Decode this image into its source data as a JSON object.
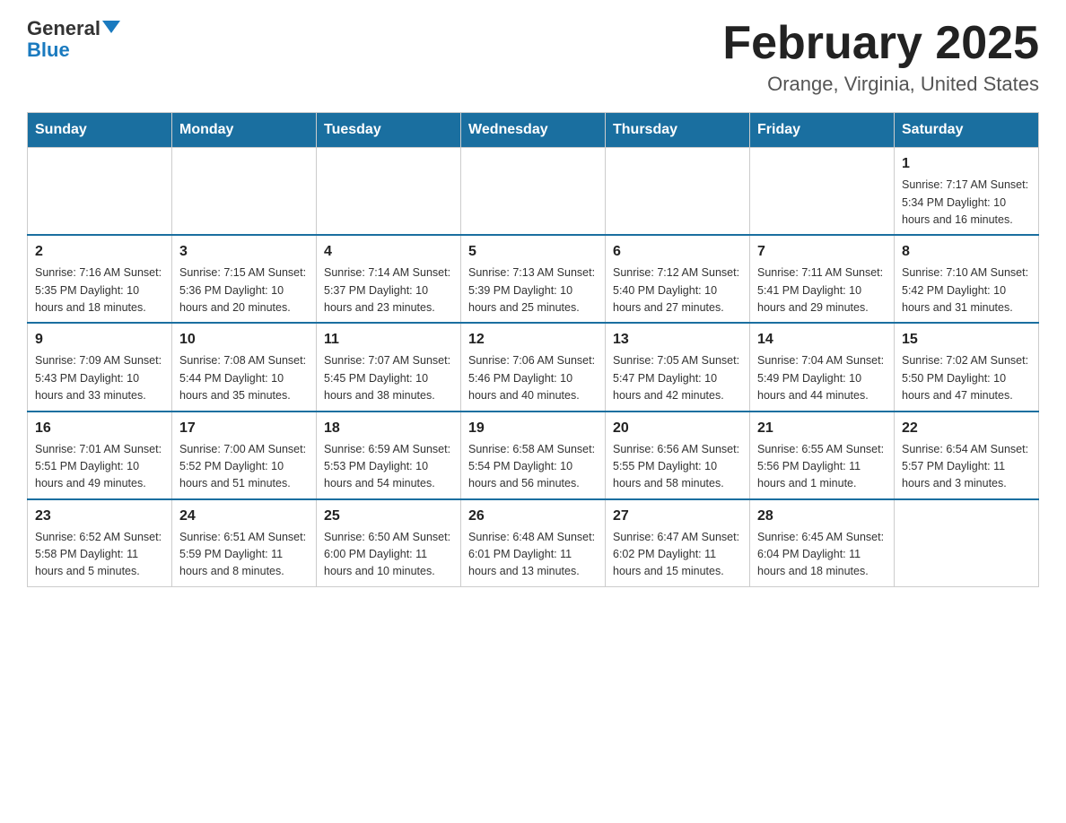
{
  "header": {
    "logo_general": "General",
    "logo_blue": "Blue",
    "month_title": "February 2025",
    "location": "Orange, Virginia, United States"
  },
  "weekdays": [
    "Sunday",
    "Monday",
    "Tuesday",
    "Wednesday",
    "Thursday",
    "Friday",
    "Saturday"
  ],
  "weeks": [
    [
      {
        "day": "",
        "info": ""
      },
      {
        "day": "",
        "info": ""
      },
      {
        "day": "",
        "info": ""
      },
      {
        "day": "",
        "info": ""
      },
      {
        "day": "",
        "info": ""
      },
      {
        "day": "",
        "info": ""
      },
      {
        "day": "1",
        "info": "Sunrise: 7:17 AM\nSunset: 5:34 PM\nDaylight: 10 hours\nand 16 minutes."
      }
    ],
    [
      {
        "day": "2",
        "info": "Sunrise: 7:16 AM\nSunset: 5:35 PM\nDaylight: 10 hours\nand 18 minutes."
      },
      {
        "day": "3",
        "info": "Sunrise: 7:15 AM\nSunset: 5:36 PM\nDaylight: 10 hours\nand 20 minutes."
      },
      {
        "day": "4",
        "info": "Sunrise: 7:14 AM\nSunset: 5:37 PM\nDaylight: 10 hours\nand 23 minutes."
      },
      {
        "day": "5",
        "info": "Sunrise: 7:13 AM\nSunset: 5:39 PM\nDaylight: 10 hours\nand 25 minutes."
      },
      {
        "day": "6",
        "info": "Sunrise: 7:12 AM\nSunset: 5:40 PM\nDaylight: 10 hours\nand 27 minutes."
      },
      {
        "day": "7",
        "info": "Sunrise: 7:11 AM\nSunset: 5:41 PM\nDaylight: 10 hours\nand 29 minutes."
      },
      {
        "day": "8",
        "info": "Sunrise: 7:10 AM\nSunset: 5:42 PM\nDaylight: 10 hours\nand 31 minutes."
      }
    ],
    [
      {
        "day": "9",
        "info": "Sunrise: 7:09 AM\nSunset: 5:43 PM\nDaylight: 10 hours\nand 33 minutes."
      },
      {
        "day": "10",
        "info": "Sunrise: 7:08 AM\nSunset: 5:44 PM\nDaylight: 10 hours\nand 35 minutes."
      },
      {
        "day": "11",
        "info": "Sunrise: 7:07 AM\nSunset: 5:45 PM\nDaylight: 10 hours\nand 38 minutes."
      },
      {
        "day": "12",
        "info": "Sunrise: 7:06 AM\nSunset: 5:46 PM\nDaylight: 10 hours\nand 40 minutes."
      },
      {
        "day": "13",
        "info": "Sunrise: 7:05 AM\nSunset: 5:47 PM\nDaylight: 10 hours\nand 42 minutes."
      },
      {
        "day": "14",
        "info": "Sunrise: 7:04 AM\nSunset: 5:49 PM\nDaylight: 10 hours\nand 44 minutes."
      },
      {
        "day": "15",
        "info": "Sunrise: 7:02 AM\nSunset: 5:50 PM\nDaylight: 10 hours\nand 47 minutes."
      }
    ],
    [
      {
        "day": "16",
        "info": "Sunrise: 7:01 AM\nSunset: 5:51 PM\nDaylight: 10 hours\nand 49 minutes."
      },
      {
        "day": "17",
        "info": "Sunrise: 7:00 AM\nSunset: 5:52 PM\nDaylight: 10 hours\nand 51 minutes."
      },
      {
        "day": "18",
        "info": "Sunrise: 6:59 AM\nSunset: 5:53 PM\nDaylight: 10 hours\nand 54 minutes."
      },
      {
        "day": "19",
        "info": "Sunrise: 6:58 AM\nSunset: 5:54 PM\nDaylight: 10 hours\nand 56 minutes."
      },
      {
        "day": "20",
        "info": "Sunrise: 6:56 AM\nSunset: 5:55 PM\nDaylight: 10 hours\nand 58 minutes."
      },
      {
        "day": "21",
        "info": "Sunrise: 6:55 AM\nSunset: 5:56 PM\nDaylight: 11 hours\nand 1 minute."
      },
      {
        "day": "22",
        "info": "Sunrise: 6:54 AM\nSunset: 5:57 PM\nDaylight: 11 hours\nand 3 minutes."
      }
    ],
    [
      {
        "day": "23",
        "info": "Sunrise: 6:52 AM\nSunset: 5:58 PM\nDaylight: 11 hours\nand 5 minutes."
      },
      {
        "day": "24",
        "info": "Sunrise: 6:51 AM\nSunset: 5:59 PM\nDaylight: 11 hours\nand 8 minutes."
      },
      {
        "day": "25",
        "info": "Sunrise: 6:50 AM\nSunset: 6:00 PM\nDaylight: 11 hours\nand 10 minutes."
      },
      {
        "day": "26",
        "info": "Sunrise: 6:48 AM\nSunset: 6:01 PM\nDaylight: 11 hours\nand 13 minutes."
      },
      {
        "day": "27",
        "info": "Sunrise: 6:47 AM\nSunset: 6:02 PM\nDaylight: 11 hours\nand 15 minutes."
      },
      {
        "day": "28",
        "info": "Sunrise: 6:45 AM\nSunset: 6:04 PM\nDaylight: 11 hours\nand 18 minutes."
      },
      {
        "day": "",
        "info": ""
      }
    ]
  ]
}
